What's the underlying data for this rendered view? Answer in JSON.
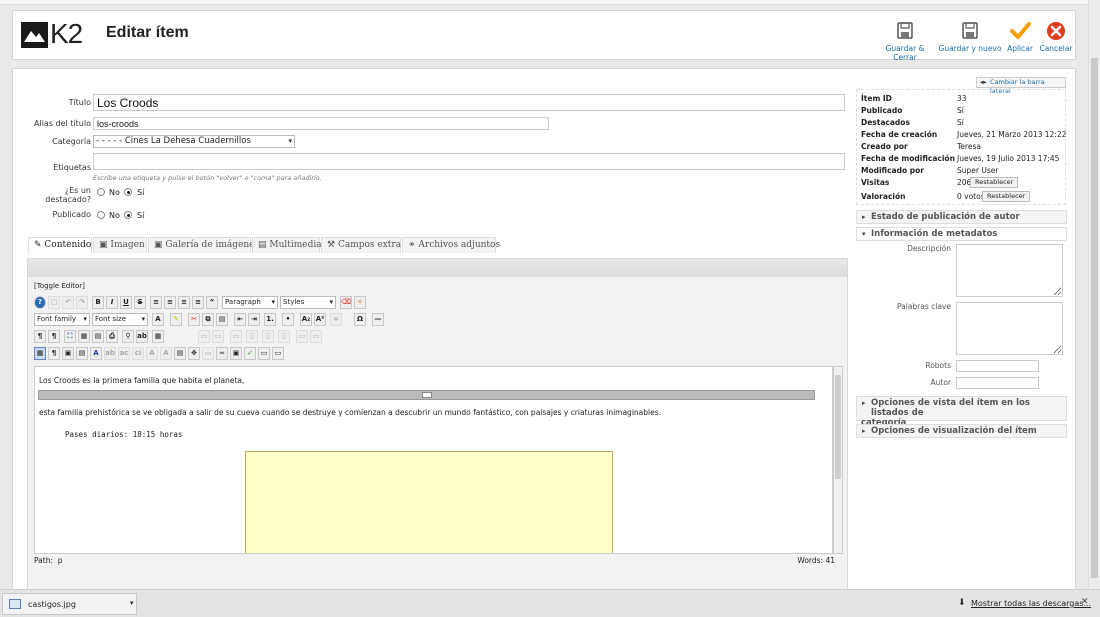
{
  "header": {
    "logo_text": "K2",
    "page_title": "Editar ítem",
    "buttons": [
      {
        "label": "Guardar & Cerrar",
        "icon": "save-icon"
      },
      {
        "label": "Guardar y nuevo",
        "icon": "save-icon"
      },
      {
        "label": "Aplicar",
        "icon": "check-icon"
      },
      {
        "label": "Cancelar",
        "icon": "cancel-icon"
      }
    ],
    "colors": {
      "apply": "#f5a000",
      "cancel": "#e03c1f",
      "link": "#1a6ea8"
    }
  },
  "form": {
    "title_label": "Título",
    "title_value": "Los Croods",
    "alias_label": "Alias del título",
    "alias_value": "los-croods",
    "category_label": "Categoría",
    "category_value": "- - - - - Cines La Dehesa Cuadernillos",
    "tags_label": "Etiquetas",
    "tags_value": "",
    "tags_hint": "Escribe una etiqueta y pulse el botón \"volver\" o \"coma\" para añadirlo.",
    "featured_label_1": "¿Es un",
    "featured_label_2": "destacado?",
    "published_label": "Publicado",
    "no": "No",
    "yes": "Sí"
  },
  "tabs": [
    {
      "label": "Contenido",
      "icon": "pencil-icon"
    },
    {
      "label": "Imagen",
      "icon": "image-icon"
    },
    {
      "label": "Galería de imágenes",
      "icon": "gallery-icon"
    },
    {
      "label": "Multimedia",
      "icon": "film-icon"
    },
    {
      "label": "Campos extra",
      "icon": "tools-icon"
    },
    {
      "label": "Archivos adjuntos",
      "icon": "paperclip-icon"
    }
  ],
  "editor": {
    "toggle_label": "[Toggle Editor]",
    "format_select": "Paragraph",
    "styles_select": "Styles",
    "font_family": "Font family",
    "font_size": "Font size",
    "line1": "Los Croods es la primera familia que habita el planeta,",
    "line2": "esta familia prehistórica se ve obligada a salir de su cueva cuando se destruye y comienzan a descubrir un mundo fantástico, con paisajes y criaturas inimaginables.",
    "line3": "Pases diarios: 18:15 horas",
    "path_label": "Path:",
    "path_value": "p",
    "words_label": "Words:",
    "words_value": "41"
  },
  "sidebar": {
    "toggle_label": "Cambiar la barra lateral",
    "info": [
      {
        "label": "Ítem ID",
        "value": "33"
      },
      {
        "label": "Publicado",
        "value": "Sí"
      },
      {
        "label": "Destacados",
        "value": "Sí"
      },
      {
        "label": "Fecha de creación",
        "value": "Jueves, 21 Marzo 2013 12:22"
      },
      {
        "label": "Creado por",
        "value": "Teresa"
      },
      {
        "label": "Fecha de modificación",
        "value": "Jueves, 19 Julio 2013 17:45"
      },
      {
        "label": "Modificado por",
        "value": "Super User"
      },
      {
        "label": "Visitas",
        "value": "206"
      },
      {
        "label": "Valoración",
        "value": "0 votos"
      }
    ],
    "reset_label": "Restablecer",
    "sections": {
      "author_status": "Estado de publicación de autor",
      "metadata": "Información de metadatos",
      "category_view_1": "Opciones de vista del ítem en los listados de",
      "category_view_2": "categoría",
      "item_view": "Opciones de visualización del ítem"
    },
    "meta": {
      "description": "Descripción",
      "keywords": "Palabras clave",
      "robots": "Robots",
      "author": "Autor"
    }
  },
  "downloads": {
    "file_name": "castigos.jpg",
    "show_all": "Mostrar todas las descargas...",
    "close": "✕"
  }
}
